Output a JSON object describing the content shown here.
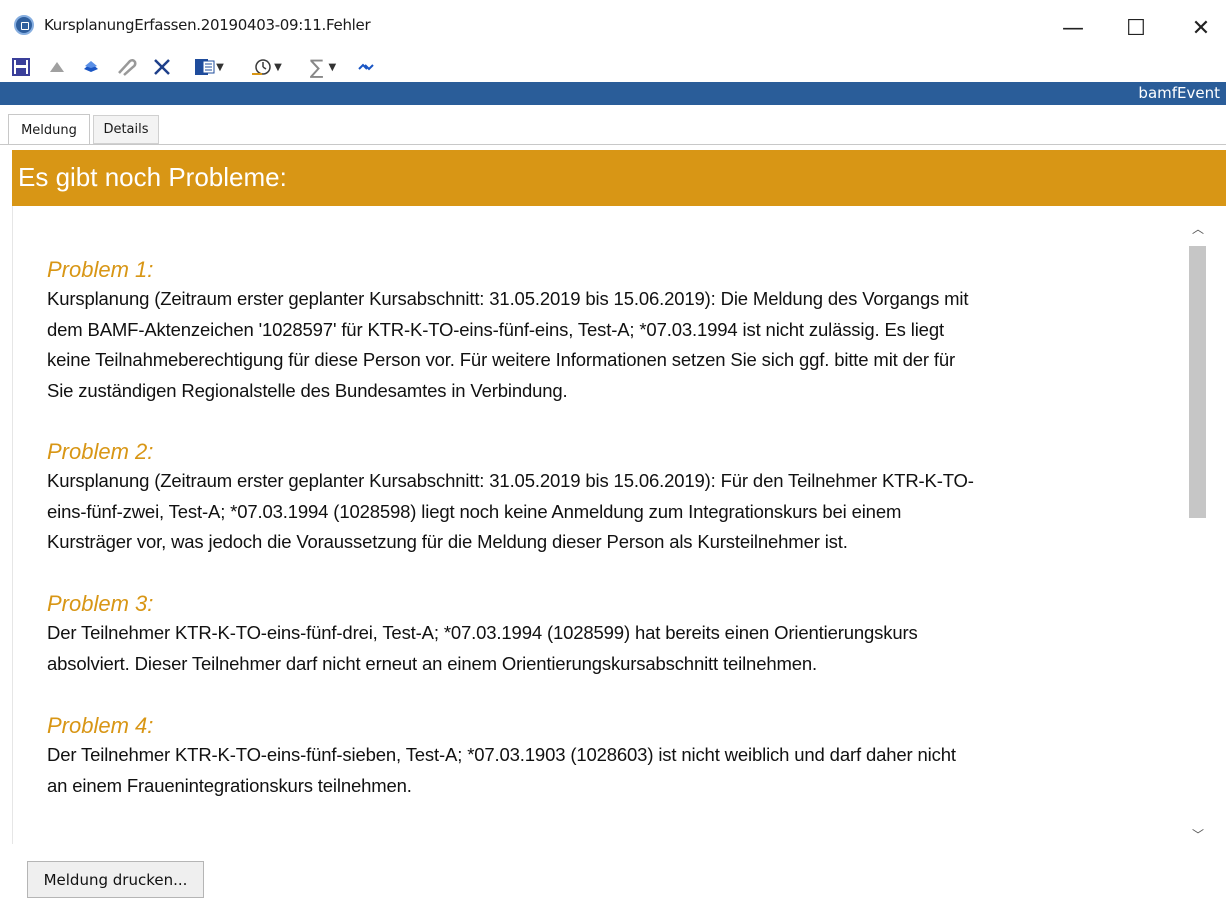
{
  "window": {
    "title": "KursplanungErfassen.20190403-09:11.Fehler",
    "minimize": "—",
    "maximize": "☐",
    "close": "✕"
  },
  "toolbar": {
    "icons": [
      "save-icon",
      "arrow-up-icon",
      "arrow-down-icon",
      "attach-icon",
      "delete-icon",
      "word-export-icon",
      "history-icon",
      "sum-icon",
      "refresh-icon"
    ]
  },
  "banner": {
    "label": "bamfEvent"
  },
  "tabs": [
    {
      "label": "Meldung",
      "active": true
    },
    {
      "label": "Details",
      "active": false
    }
  ],
  "header": {
    "title": "Es gibt noch Probleme:"
  },
  "problems": [
    {
      "title": "Problem 1:",
      "lines": [
        "Kursplanung (Zeitraum erster geplanter Kursabschnitt: 31.05.2019 bis 15.06.2019): Die Meldung des Vorgangs mit",
        "dem BAMF-Aktenzeichen '1028597' für KTR-K-TO-eins-fünf-eins, Test-A; *07.03.1994 ist nicht zulässig. Es liegt",
        "keine Teilnahmeberechtigung für diese Person vor. Für weitere Informationen setzen Sie sich ggf. bitte mit der für",
        "Sie zuständigen Regionalstelle des Bundesamtes in Verbindung."
      ]
    },
    {
      "title": "Problem 2:",
      "lines": [
        "Kursplanung (Zeitraum erster geplanter Kursabschnitt: 31.05.2019 bis 15.06.2019): Für den Teilnehmer KTR-K-TO-",
        "eins-fünf-zwei, Test-A; *07.03.1994 (1028598) liegt noch keine Anmeldung zum Integrationskurs bei einem",
        "Kursträger vor, was jedoch die Voraussetzung für die Meldung dieser Person als Kursteilnehmer ist."
      ]
    },
    {
      "title": "Problem 3:",
      "lines": [
        "Der Teilnehmer KTR-K-TO-eins-fünf-drei, Test-A; *07.03.1994 (1028599) hat bereits einen Orientierungskurs",
        "absolviert. Dieser Teilnehmer darf nicht erneut an einem Orientierungskursabschnitt teilnehmen."
      ]
    },
    {
      "title": "Problem 4:",
      "lines": [
        "Der Teilnehmer KTR-K-TO-eins-fünf-sieben, Test-A; *07.03.1903 (1028603) ist nicht weiblich und darf daher nicht",
        "an einem Frauenintegrationskurs teilnehmen."
      ]
    }
  ],
  "footer": {
    "print_button": "Meldung drucken..."
  },
  "colors": {
    "accent": "#d89615",
    "banner": "#2a5d99"
  }
}
